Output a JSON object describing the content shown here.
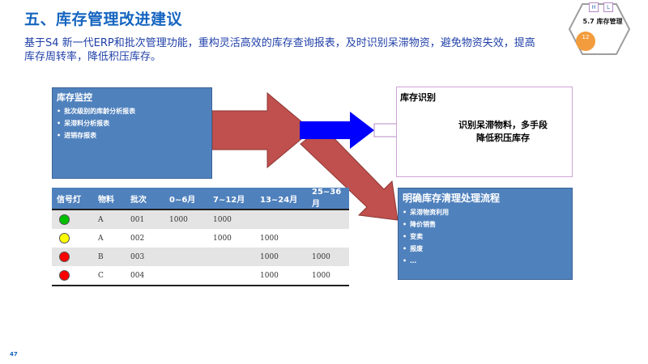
{
  "header": {
    "title": "五、库存管理改进建议",
    "subtitle": "基于S4 新一代ERP和批次管理功能，重构灵活高效的库存查询报表，及时识别呆滞物资，避免物资失效，提高库存周转率，降低积压库存。"
  },
  "badge": {
    "label": "5.7 库存管理",
    "tag_h": "H",
    "tag_l": "L",
    "number": "12"
  },
  "monitor_box": {
    "title": "库存监控",
    "items": [
      "批次级别的库龄分析报表",
      "呆滞料分析报表",
      "进销存报表"
    ]
  },
  "identify_box": {
    "title": "库存识别",
    "text_line1": "识别呆滞物料，多手段",
    "text_line2": "降低积压库存"
  },
  "cleanup_box": {
    "title": "明确库存清理处理流程",
    "items": [
      "呆滞物资利用",
      "降价销售",
      "变卖",
      "报废",
      "…"
    ]
  },
  "table": {
    "headers": [
      "信号灯",
      "物料",
      "批次",
      "0~6月",
      "7~12月",
      "13~24月",
      "25~36月"
    ],
    "rows": [
      {
        "light": "green",
        "cells": [
          "A",
          "001",
          "1000",
          "1000",
          "",
          ""
        ]
      },
      {
        "light": "yellow",
        "cells": [
          "A",
          "002",
          "",
          "1000",
          "1000",
          ""
        ]
      },
      {
        "light": "red",
        "cells": [
          "B",
          "003",
          "",
          "",
          "1000",
          "1000"
        ]
      },
      {
        "light": "red",
        "cells": [
          "C",
          "004",
          "",
          "",
          "1000",
          "1000"
        ]
      }
    ]
  },
  "colors": {
    "title": "#1565C0",
    "box_blue": "#4F81BD",
    "arrow_red": "#C0504D",
    "arrow_blue": "#0000FF",
    "green": "#00C000",
    "yellow": "#FFFF00",
    "red": "#FF0000"
  },
  "page_number": "47"
}
